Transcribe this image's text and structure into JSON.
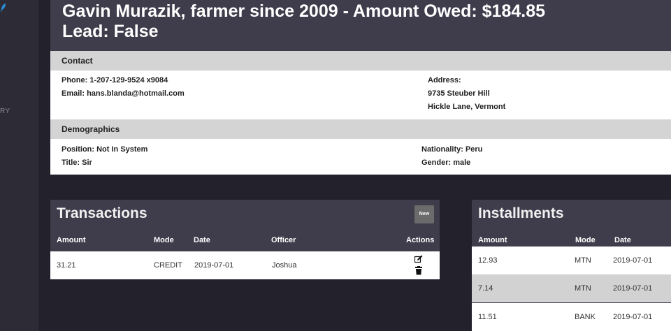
{
  "sidebar": {
    "nav_label": "RY",
    "logo_icon": "feather-icon",
    "accent": "#2a8fd8"
  },
  "header": {
    "title_line1": "Gavin Murazik, farmer since 2009 - Amount Owed: $184.85",
    "title_line2": "Lead: False"
  },
  "contact": {
    "heading": "Contact",
    "phone": "Phone: 1-207-129-9524 x9084",
    "email": "Email: hans.blanda@hotmail.com",
    "address_label": "Address:",
    "address_line1": "9735 Steuber Hill",
    "address_line2": "Hickle Lane, Vermont"
  },
  "demographics": {
    "heading": "Demographics",
    "position": "Position: Not In System",
    "title": "Title: Sir",
    "nationality": "Nationality: Peru",
    "gender": "Gender: male"
  },
  "transactions": {
    "title": "Transactions",
    "new_label": "New",
    "columns": [
      "Amount",
      "Mode",
      "Date",
      "Officer",
      "Actions"
    ],
    "rows": [
      {
        "amount": "31.21",
        "mode": "CREDIT",
        "date": "2019-07-01",
        "officer": "Joshua"
      }
    ],
    "action_icons": [
      "edit-icon",
      "trash-icon"
    ]
  },
  "installments": {
    "title": "Installments",
    "columns": [
      "Amount",
      "Mode",
      "Date"
    ],
    "rows": [
      {
        "amount": "12.93",
        "mode": "MTN",
        "date": "2019-07-01"
      },
      {
        "amount": "7.14",
        "mode": "MTN",
        "date": "2019-07-01"
      },
      {
        "amount": "11.51",
        "mode": "BANK",
        "date": "2019-07-01"
      }
    ]
  }
}
